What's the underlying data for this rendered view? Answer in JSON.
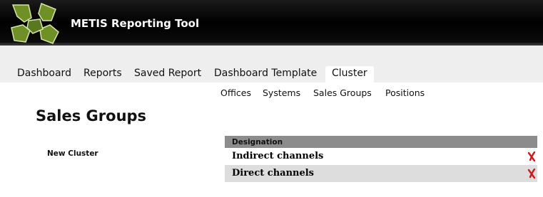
{
  "header": {
    "app_title": "METIS Reporting Tool",
    "logo_icon": "metis-logo-icon",
    "logo_color": "#7a9a2c"
  },
  "tabs": [
    {
      "label": "Dashboard"
    },
    {
      "label": "Reports"
    },
    {
      "label": "Saved Report"
    },
    {
      "label": "Dashboard Template"
    },
    {
      "label": "Cluster",
      "active": true
    }
  ],
  "subnav": [
    {
      "label": "Offices"
    },
    {
      "label": "Systems"
    },
    {
      "label": "Sales Groups"
    },
    {
      "label": "Positions"
    }
  ],
  "page": {
    "title": "Sales Groups",
    "new_cluster_label": "New Cluster"
  },
  "table": {
    "header": "Designation",
    "rows": [
      {
        "designation": "Indirect channels",
        "action_icon": "delete-icon"
      },
      {
        "designation": "Direct channels",
        "action_icon": "delete-icon"
      }
    ]
  },
  "colors": {
    "delete": "#d01818",
    "header_bg": "#000000",
    "table_header": "#8c8c8c",
    "row_alt": "#dddddd"
  }
}
